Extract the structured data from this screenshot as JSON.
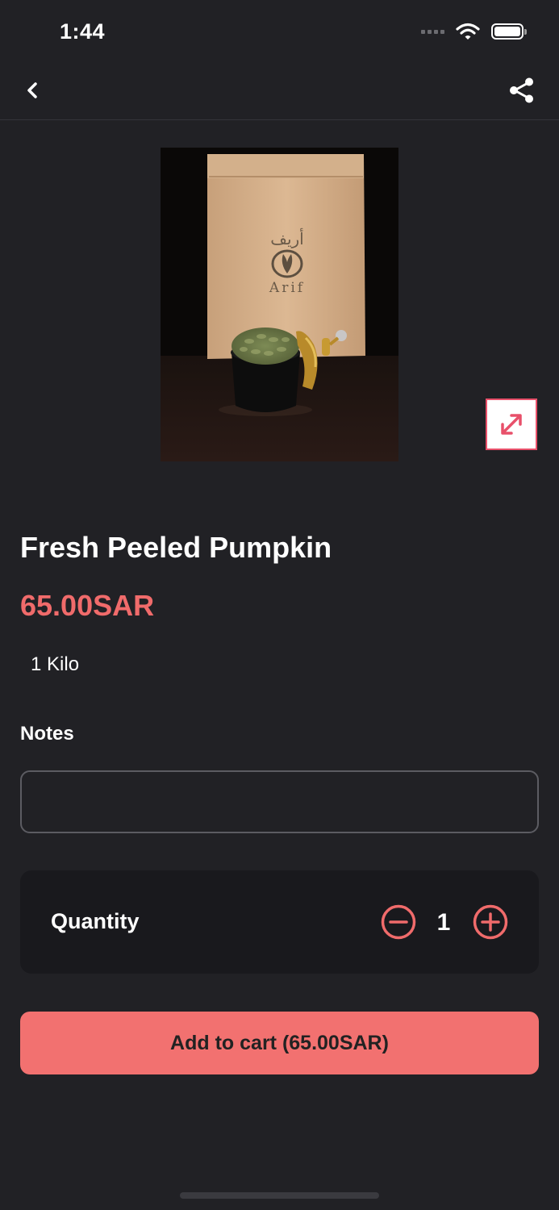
{
  "status_bar": {
    "time": "1:44"
  },
  "product": {
    "image_alt": "Pumpkin seeds",
    "title": "Fresh Peeled Pumpkin",
    "price": "65.00SAR",
    "unit": "1 Kilo",
    "package_text_ar": "أريف",
    "package_text_en": "Arif"
  },
  "notes": {
    "label": "Notes",
    "value": "",
    "placeholder": ""
  },
  "quantity": {
    "label": "Quantity",
    "value": "1"
  },
  "cart": {
    "button_label": "Add to cart (65.00SAR)"
  },
  "icons": {
    "back": "chevron-left-icon",
    "share": "share-icon",
    "expand": "expand-icon",
    "minus": "minus-circle-icon",
    "plus": "plus-circle-icon"
  },
  "colors": {
    "background": "#212125",
    "accent": "#f06b6b",
    "button": "#f27170",
    "card": "#19191d",
    "expand_border": "#e8506a"
  }
}
